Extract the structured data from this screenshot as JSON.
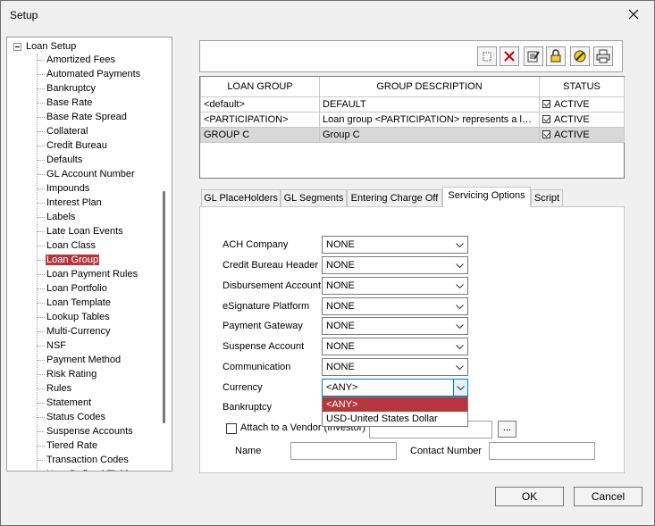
{
  "window": {
    "title": "Setup"
  },
  "tree": {
    "root": "Loan Setup",
    "items": [
      "Amortized Fees",
      "Automated Payments",
      "Bankruptcy",
      "Base Rate",
      "Base Rate Spread",
      "Collateral",
      "Credit Bureau",
      "Defaults",
      "GL Account Number",
      "Impounds",
      "Interest Plan",
      "Labels",
      "Late Loan Events",
      "Loan Class",
      "Loan Group",
      "Loan Payment Rules",
      "Loan Portfolio",
      "Loan Template",
      "Lookup Tables",
      "Multi-Currency",
      "NSF",
      "Payment Method",
      "Risk Rating",
      "Rules",
      "Statement",
      "Status Codes",
      "Suspense Accounts",
      "Tiered Rate",
      "Transaction Codes",
      "User Defined Fields"
    ],
    "selected": "Loan Group"
  },
  "toolbar": {
    "buttons": [
      "new-icon",
      "delete-icon",
      "edit-icon",
      "lock-icon",
      "tools-icon",
      "print-icon"
    ]
  },
  "grid": {
    "headers": [
      "LOAN GROUP",
      "GROUP DESCRIPTION",
      "STATUS"
    ],
    "rows": [
      {
        "group": "<default>",
        "description": "DEFAULT",
        "status": "ACTIVE"
      },
      {
        "group": "<PARTICIPATION>",
        "description": "Loan group <PARTICIPATION> represents a loan participation",
        "status": "ACTIVE"
      },
      {
        "group": "GROUP C",
        "description": "Group C",
        "status": "ACTIVE"
      }
    ],
    "selected_row": 2
  },
  "tabs": [
    "GL PlaceHolders",
    "GL Segments",
    "Entering Charge Off",
    "Servicing Options",
    "Script"
  ],
  "active_tab": "Servicing Options",
  "form": {
    "fields": [
      {
        "label": "ACH Company",
        "value": "NONE"
      },
      {
        "label": "Credit Bureau Header",
        "value": "NONE"
      },
      {
        "label": "Disbursement Account",
        "value": "NONE"
      },
      {
        "label": "eSignature Platform",
        "value": "NONE"
      },
      {
        "label": "Payment Gateway",
        "value": "NONE"
      },
      {
        "label": "Suspense Account",
        "value": "NONE"
      },
      {
        "label": "Communication",
        "value": "NONE"
      },
      {
        "label": "Currency",
        "value": "<ANY>"
      },
      {
        "label": "Bankruptcy",
        "value": ""
      }
    ],
    "currency_options": [
      "<ANY>",
      "USD-United States Dollar"
    ],
    "vendor_checkbox_label": "Attach to a Vendor (Investor)",
    "vendor_button": "...",
    "name_label": "Name",
    "contact_label": "Contact Number"
  },
  "buttons": {
    "ok": "OK",
    "cancel": "Cancel"
  },
  "colors": {
    "selection": "#b5373b",
    "focus": "#0078d7"
  }
}
